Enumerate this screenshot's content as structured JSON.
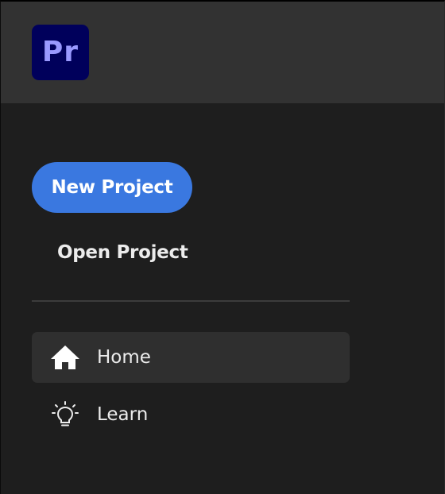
{
  "app": {
    "logo_text": "Pr",
    "logo_bg": "#00005b",
    "logo_fg": "#9999ff"
  },
  "actions": {
    "new_project_label": "New Project",
    "open_project_label": "Open Project",
    "accent": "#3a78e0"
  },
  "nav": {
    "items": [
      {
        "label": "Home",
        "icon": "home-icon",
        "active": true
      },
      {
        "label": "Learn",
        "icon": "lightbulb-icon",
        "active": false
      }
    ]
  }
}
